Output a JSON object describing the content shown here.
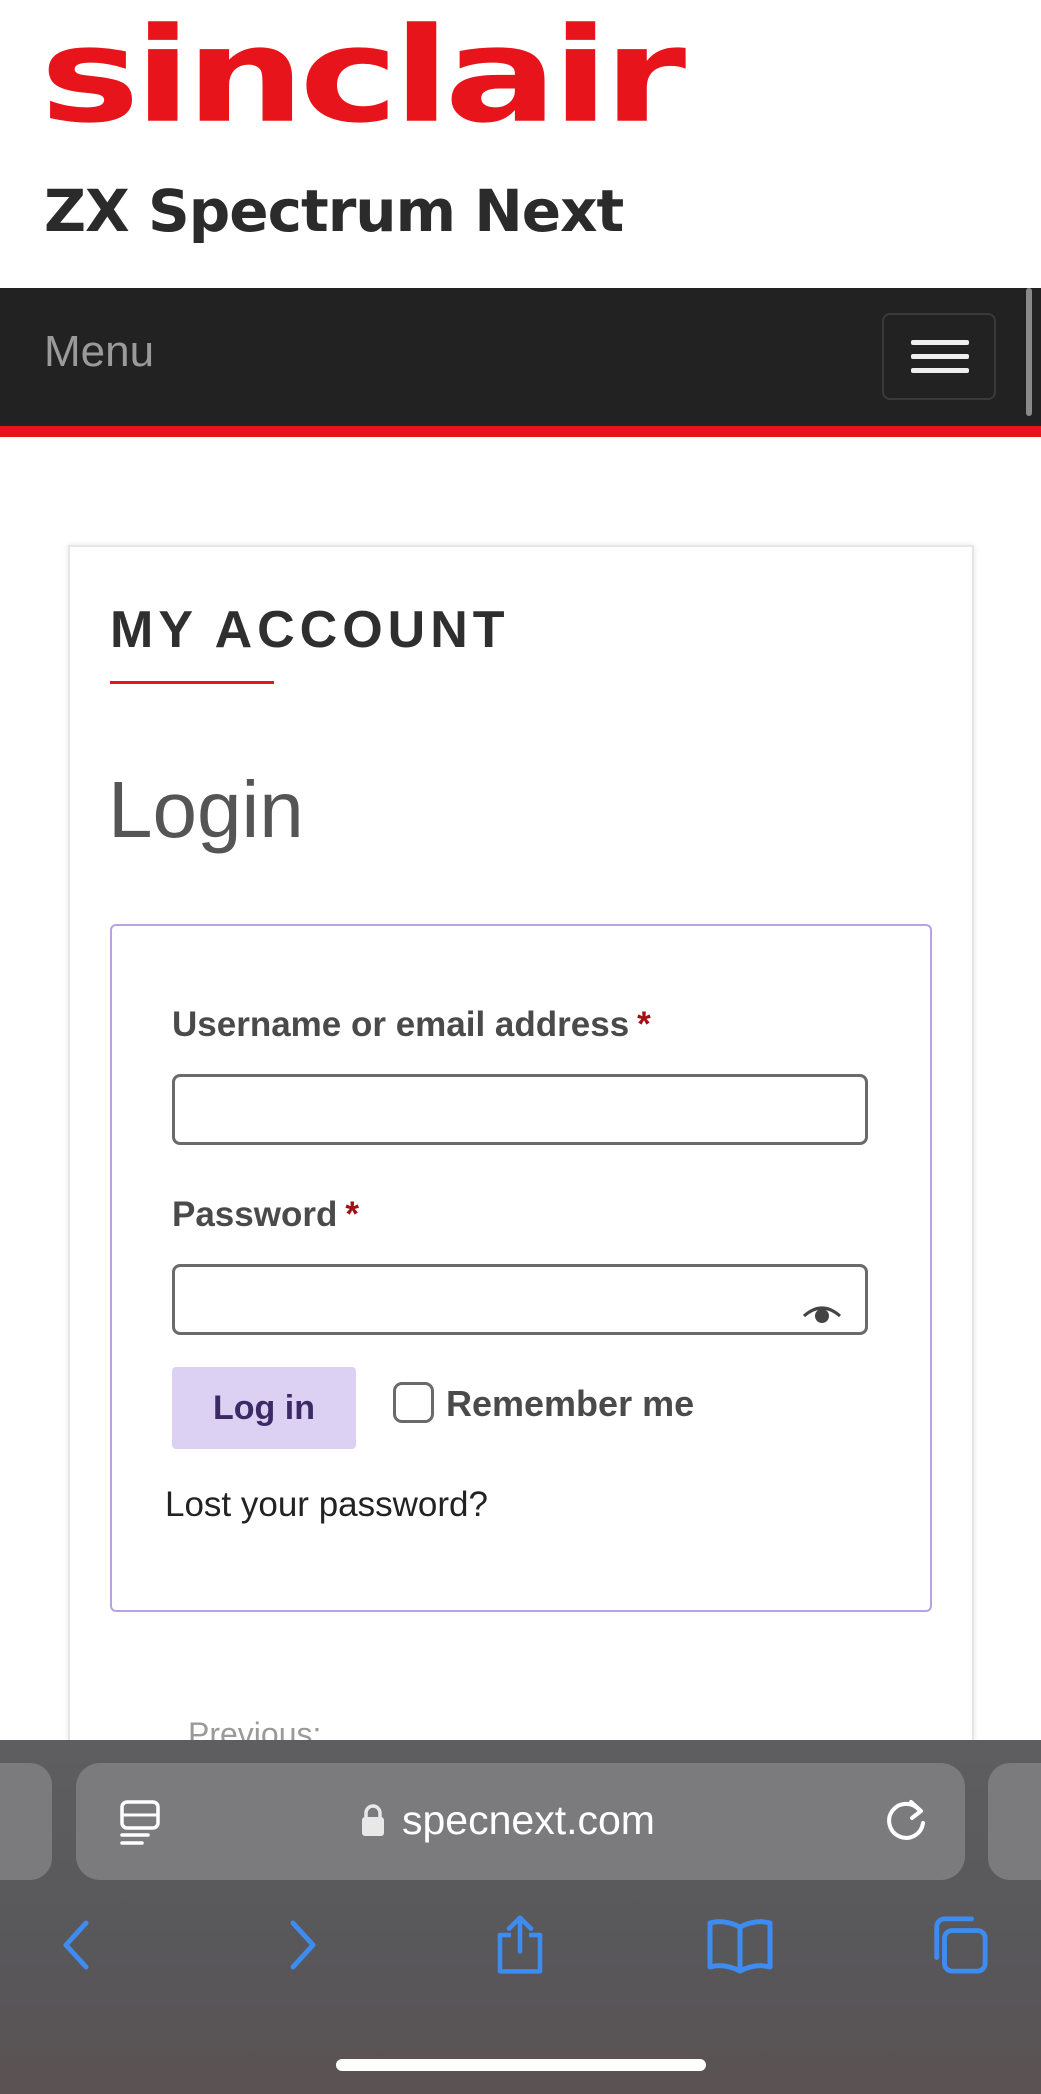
{
  "header": {
    "logo_word": "sinclair",
    "logo_sub": "ZX Spectrum Next",
    "logo_color": "#e8141b"
  },
  "nav": {
    "menu_label": "Menu",
    "toggle_icon": "hamburger-menu-icon"
  },
  "main": {
    "section_title": "MY ACCOUNT",
    "login_heading": "Login",
    "form": {
      "username_label": "Username or email address",
      "password_label": "Password",
      "required_mark": "*",
      "username_value": "",
      "password_value": "",
      "login_button": "Log in",
      "remember_label": "Remember me",
      "lost_password_link": "Lost your password?"
    },
    "previous_label": "Previous:"
  },
  "browser": {
    "url": "specnext.com",
    "icons": [
      "reader-icon",
      "lock-icon",
      "reload-icon",
      "back-icon",
      "forward-icon",
      "share-icon",
      "bookmarks-icon",
      "tabs-icon"
    ]
  },
  "colors": {
    "accent_red": "#e8141b",
    "nav_bg": "#222222",
    "form_border": "#b9a3df",
    "button_bg": "#dcd1f3",
    "toolbar_icon": "#3e8cf0"
  }
}
